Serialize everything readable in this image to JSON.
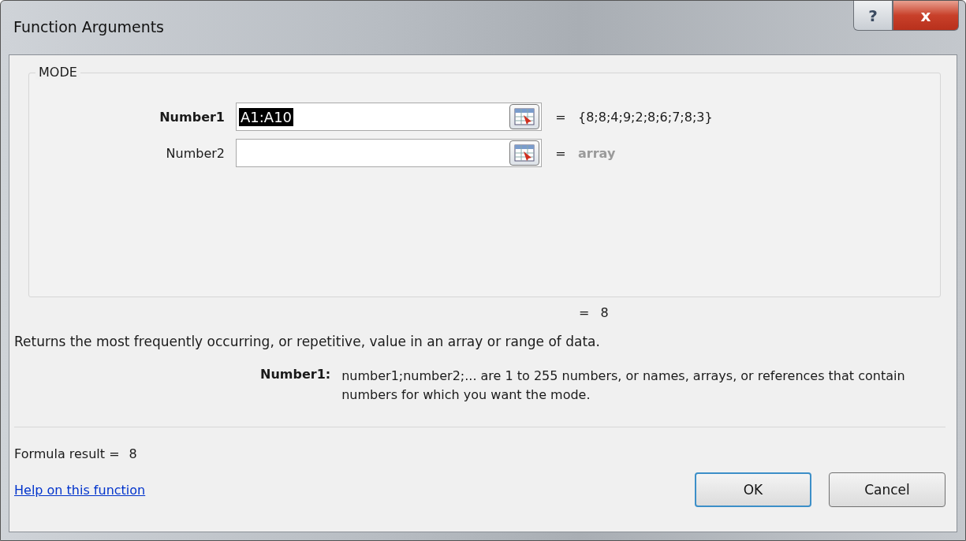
{
  "window": {
    "title": "Function Arguments",
    "title_buttons": [
      {
        "kind": "help",
        "label": "?"
      },
      {
        "kind": "close",
        "label": "x"
      }
    ]
  },
  "group": {
    "title": "MODE",
    "arguments": [
      {
        "label": "Number1",
        "required": true,
        "value": "A1:A10",
        "text_selected": true,
        "sign": "=",
        "result": "{8;8;4;9;2;8;6;7;8;3}",
        "evaluated": true
      },
      {
        "label": "Number2",
        "required": false,
        "sign": "=",
        "result": "array",
        "evaluated": false
      }
    ]
  },
  "function_result": {
    "sign": "=",
    "value": "8"
  },
  "description": "Returns the most frequently occurring, or repetitive, value in an array or range of data.",
  "argument_help": {
    "label": "Number1:",
    "text": "number1;number2;... are 1 to 255 numbers, or names, arrays, or references that contain numbers for which you want the mode."
  },
  "formula_result": {
    "label": "Formula result =",
    "value": "8"
  },
  "help_link": "Help on this function",
  "buttons": [
    {
      "label": "OK",
      "default": true
    },
    {
      "label": "Cancel",
      "default": false
    }
  ]
}
